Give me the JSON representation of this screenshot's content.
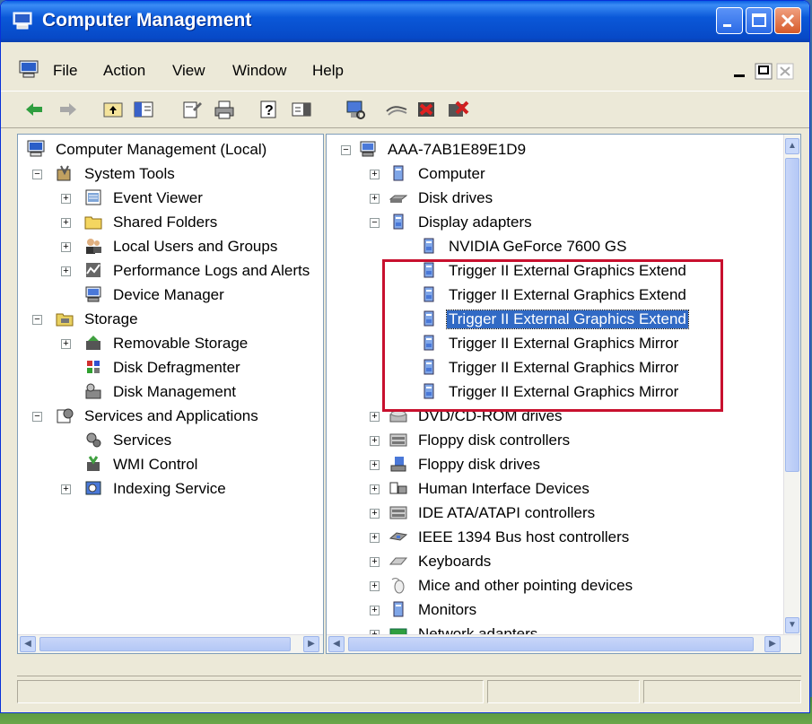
{
  "window": {
    "title": "Computer Management"
  },
  "menu": [
    "File",
    "Action",
    "View",
    "Window",
    "Help"
  ],
  "left_tree": [
    {
      "label": "Computer Management (Local)",
      "icon": "computer-mgmt-icon"
    },
    {
      "label": "System Tools",
      "icon": "system-tools-icon"
    },
    {
      "label": "Event Viewer",
      "icon": "event-viewer-icon"
    },
    {
      "label": "Shared Folders",
      "icon": "shared-folders-icon"
    },
    {
      "label": "Local Users and Groups",
      "icon": "users-icon"
    },
    {
      "label": "Performance Logs and Alerts",
      "icon": "performance-icon"
    },
    {
      "label": "Device Manager",
      "icon": "device-manager-icon"
    },
    {
      "label": "Storage",
      "icon": "storage-icon"
    },
    {
      "label": "Removable Storage",
      "icon": "removable-storage-icon"
    },
    {
      "label": "Disk Defragmenter",
      "icon": "defrag-icon"
    },
    {
      "label": "Disk Management",
      "icon": "disk-management-icon"
    },
    {
      "label": "Services and Applications",
      "icon": "services-apps-icon"
    },
    {
      "label": "Services",
      "icon": "services-icon"
    },
    {
      "label": "WMI Control",
      "icon": "wmi-icon"
    },
    {
      "label": "Indexing Service",
      "icon": "indexing-icon"
    }
  ],
  "right_tree": [
    {
      "label": "AAA-7AB1E89E1D9",
      "icon": "computer-icon"
    },
    {
      "label": "Computer",
      "icon": "computer-icon"
    },
    {
      "label": "Disk drives",
      "icon": "disk-drive-icon"
    },
    {
      "label": "Display adapters",
      "icon": "display-adapter-icon"
    },
    {
      "label": "NVIDIA GeForce 7600 GS",
      "icon": "display-adapter-icon"
    },
    {
      "label": "Trigger II External Graphics Extend",
      "icon": "display-adapter-icon"
    },
    {
      "label": "Trigger II External Graphics Extend",
      "icon": "display-adapter-icon"
    },
    {
      "label": "Trigger II External Graphics Extend",
      "icon": "display-adapter-icon"
    },
    {
      "label": "Trigger II External Graphics Mirror",
      "icon": "display-adapter-icon"
    },
    {
      "label": "Trigger II External Graphics Mirror",
      "icon": "display-adapter-icon"
    },
    {
      "label": "Trigger II External Graphics Mirror",
      "icon": "display-adapter-icon"
    },
    {
      "label": "DVD/CD-ROM drives",
      "icon": "dvd-drive-icon"
    },
    {
      "label": "Floppy disk controllers",
      "icon": "controller-icon"
    },
    {
      "label": "Floppy disk drives",
      "icon": "floppy-drive-icon"
    },
    {
      "label": "Human Interface Devices",
      "icon": "hid-icon"
    },
    {
      "label": "IDE ATA/ATAPI controllers",
      "icon": "controller-icon"
    },
    {
      "label": "IEEE 1394 Bus host controllers",
      "icon": "ieee1394-icon"
    },
    {
      "label": "Keyboards",
      "icon": "keyboard-icon"
    },
    {
      "label": "Mice and other pointing devices",
      "icon": "mouse-icon"
    },
    {
      "label": "Monitors",
      "icon": "monitor-icon"
    },
    {
      "label": "Network adapters",
      "icon": "network-adapter-icon"
    }
  ],
  "colors": {
    "titlebar": "#0a58d8",
    "selection": "#316ac5",
    "highlight_box": "#c8102e",
    "window_bg": "#ece9d8"
  }
}
